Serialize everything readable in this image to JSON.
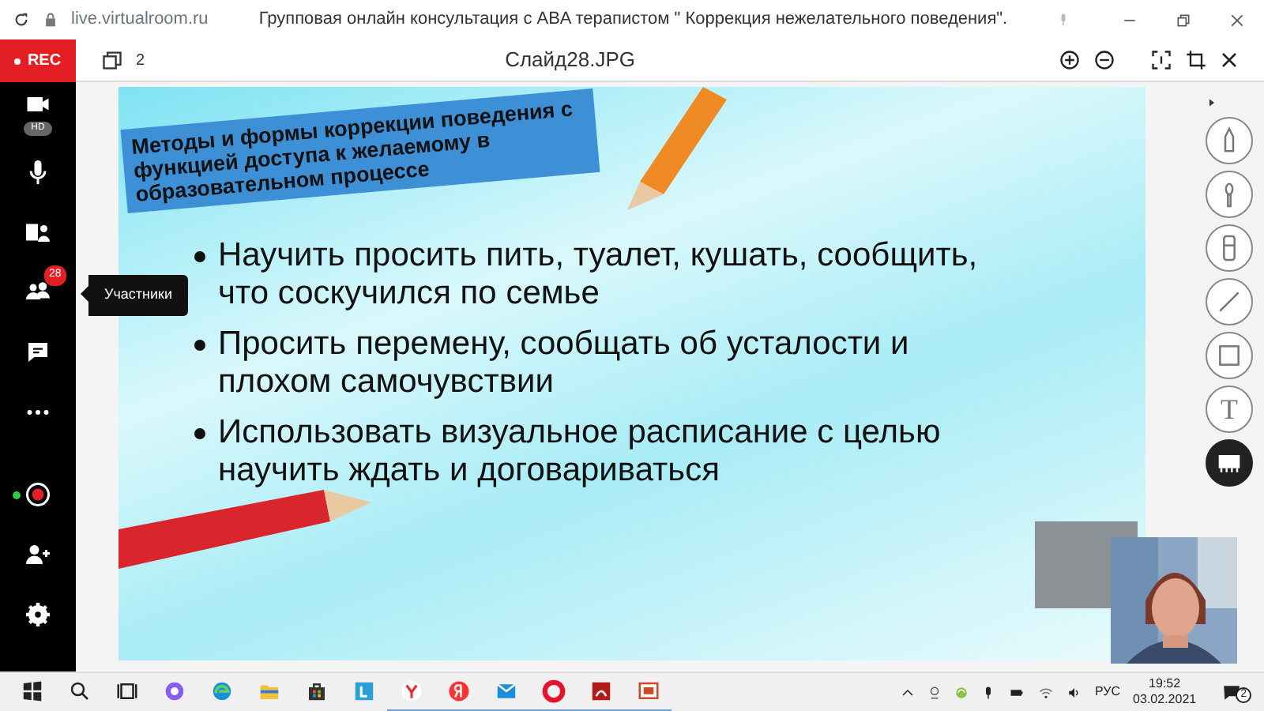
{
  "browser": {
    "url": "live.virtualroom.ru",
    "title": "Групповая онлайн консультация с ABA терапистом \" Коррекция нежелательного поведения\"."
  },
  "rec_label": "REC",
  "viewer": {
    "page_count": "2",
    "file_name": "Слайд28.JPG"
  },
  "sidebar": {
    "items": [
      {
        "kind": "camera",
        "toggle": "HD"
      },
      {
        "kind": "mic"
      },
      {
        "kind": "share"
      },
      {
        "kind": "participants",
        "badge": "28",
        "tooltip": "Участники"
      },
      {
        "kind": "chat"
      },
      {
        "kind": "more"
      },
      {
        "kind": "record",
        "online": true
      },
      {
        "kind": "invite"
      },
      {
        "kind": "settings"
      }
    ]
  },
  "slide": {
    "title": "Методы и формы коррекции поведения с функцией доступа к желаемому в образовательном процессе",
    "bullets": [
      "Научить просить пить, туалет, кушать, сообщить, что соскучился по семье",
      "Просить перемену, сообщать об усталости и плохом самочувствии",
      "Использовать визуальное расписание с целью научить ждать и договариваться"
    ]
  },
  "tools": [
    {
      "kind": "pencil"
    },
    {
      "kind": "brush"
    },
    {
      "kind": "marker"
    },
    {
      "kind": "line"
    },
    {
      "kind": "rectangle"
    },
    {
      "kind": "text",
      "glyph": "T"
    },
    {
      "kind": "board"
    }
  ],
  "taskbar": {
    "apps": [
      {
        "kind": "start",
        "running": false
      },
      {
        "kind": "search",
        "running": false
      },
      {
        "kind": "taskview",
        "running": false
      },
      {
        "kind": "alice",
        "running": false
      },
      {
        "kind": "edge",
        "running": false
      },
      {
        "kind": "folder",
        "running": false
      },
      {
        "kind": "store",
        "running": false
      },
      {
        "kind": "l-app",
        "running": false
      },
      {
        "kind": "ybrowser",
        "running": true
      },
      {
        "kind": "yandex",
        "running": true
      },
      {
        "kind": "mail",
        "running": true
      },
      {
        "kind": "opera",
        "running": true
      },
      {
        "kind": "pdf",
        "running": true
      },
      {
        "kind": "slides",
        "running": true
      }
    ],
    "language": "РУС",
    "time": "19:52",
    "date": "03.02.2021",
    "notifications": "2"
  }
}
